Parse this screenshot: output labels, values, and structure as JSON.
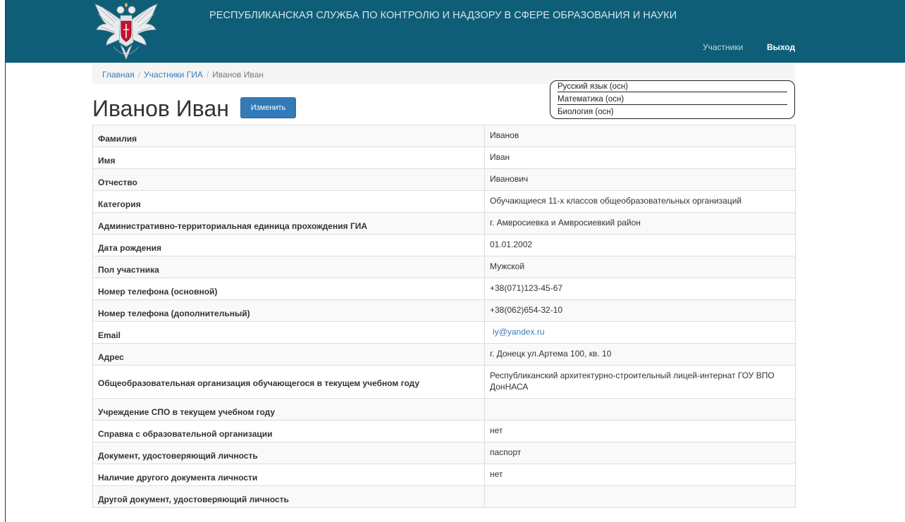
{
  "header": {
    "title": "РЕСПУБЛИКАНСКАЯ СЛУЖБА ПО КОНТРОЛЮ И НАДЗОРУ В СФЕРЕ ОБРАЗОВАНИЯ И НАУКИ",
    "nav": {
      "participants": "Участники",
      "exit": "Выход"
    },
    "emblem_icon": "coat-of-arms-eagle"
  },
  "breadcrumb": {
    "home": "Главная",
    "section": "Участники ГИА",
    "current": "Иванов Иван"
  },
  "page": {
    "title": "Иванов Иван",
    "edit_label": "Изменить"
  },
  "subjects": [
    "Русский язык (осн)",
    "Математика (осн)",
    "Биология (осн)"
  ],
  "rows": [
    {
      "label": "Фамилия",
      "value": "Иванов"
    },
    {
      "label": "Имя",
      "value": "Иван"
    },
    {
      "label": "Отчество",
      "value": "Иванович"
    },
    {
      "label": "Категория",
      "value": "Обучающиеся 11-х классов общеобразовательных организаций"
    },
    {
      "label": "Административно-территориальная единица прохождения ГИА",
      "value": "г. Амвросиевка и Амвросиевкий район"
    },
    {
      "label": "Дата рождения",
      "value": "01.01.2002"
    },
    {
      "label": "Пол участника",
      "value": "Мужской"
    },
    {
      "label": "Номер телефона (основной)",
      "value": "+38(071)123-45-67"
    },
    {
      "label": "Номер телефона (дополнительный)",
      "value": "+38(062)654-32-10"
    },
    {
      "label": "Email",
      "value": "iy@yandex.ru"
    },
    {
      "label": "Адрес",
      "value": "г. Донецк ул.Артема 100, кв. 10"
    },
    {
      "label": "Общеобразовательная организация обучающегося в текущем учебном году",
      "value": "Республиканский архитектурно-строительный лицей-интернат ГОУ ВПО ДонНАСА"
    },
    {
      "label": "Учреждение СПО в текущем учебном году",
      "value": ""
    },
    {
      "label": "Справка с образовательной организации",
      "value": "нет"
    },
    {
      "label": "Документ, удостоверяющий личность",
      "value": "паспорт"
    },
    {
      "label": "Наличие другого документа личности",
      "value": "нет"
    },
    {
      "label": "Другой документ, удостоверяющий личность",
      "value": ""
    }
  ],
  "colors": {
    "header_bg": "#0f5e78",
    "link": "#3a7bbd",
    "button_bg": "#337ab7",
    "table_stripe": "#f9f9f9"
  }
}
